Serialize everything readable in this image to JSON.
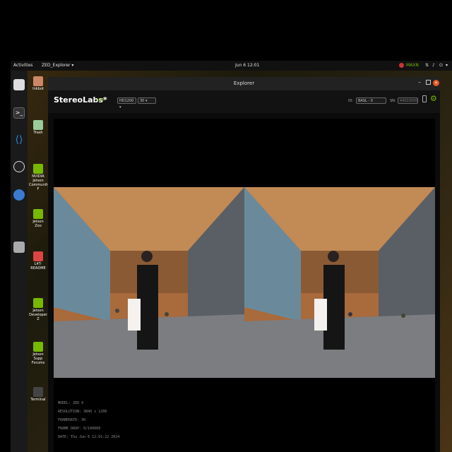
{
  "topbar": {
    "activities": "Activities",
    "app_menu": "ZED_Explorer ▾",
    "clock": "Jun 6  12:01",
    "power_mode": "MAXN"
  },
  "window": {
    "title": "Explorer"
  },
  "toolbar": {
    "logo": "StereoLabs*",
    "live_label": "LIVE",
    "resolution_option": "HD1200 ▾",
    "fps_option": "30 ▾",
    "id_label": "ID:",
    "device_option": "BASL - 0",
    "sn_label": "SN:",
    "sn_value": "44020000"
  },
  "desktop_icons": [
    {
      "label": "Inkbot"
    },
    {
      "label": "Trash"
    },
    {
      "label": "NVIDIA Jetson Community F"
    },
    {
      "label": "Jetson Zoo"
    },
    {
      "label": "L4T-README"
    },
    {
      "label": "Jetson Developer Z"
    },
    {
      "label": "Jetson Supp Forums"
    },
    {
      "label": "Terminal"
    }
  ],
  "info": {
    "model": "MODEL: ZED X",
    "resolution": "RESOLUTION: 3840 x 1200",
    "framerate": "FRAMERATE: 30",
    "frame_drop": "FRAME DROP: 0/100000",
    "date": "DATE: Thu Jun 6 12:01:22 2024"
  },
  "colors": {
    "accent": "#76b900",
    "titlebar_bg": "#222222",
    "close_button": "#e95420"
  }
}
